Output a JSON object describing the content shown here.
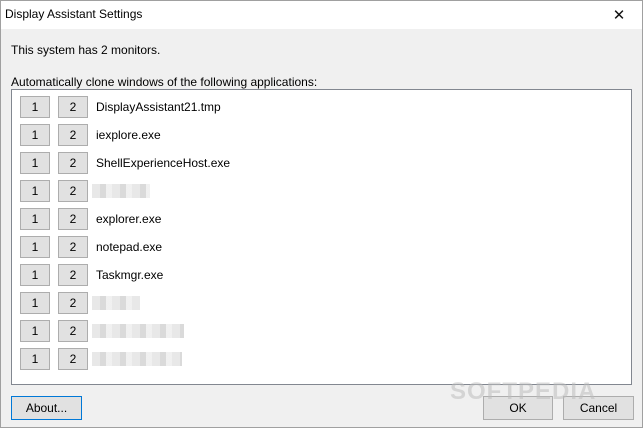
{
  "window": {
    "title": "Display Assistant Settings",
    "close_symbol": "✕"
  },
  "info_text": "This system has 2 monitors.",
  "list_label": "Automatically clone windows of the following applications:",
  "monitor_buttons": [
    "1",
    "2"
  ],
  "apps": [
    {
      "name": "DisplayAssistant21.tmp",
      "blurred": false
    },
    {
      "name": "iexplore.exe",
      "blurred": false
    },
    {
      "name": "ShellExperienceHost.exe",
      "blurred": false
    },
    {
      "name": "",
      "blurred": true
    },
    {
      "name": "explorer.exe",
      "blurred": false
    },
    {
      "name": "notepad.exe",
      "blurred": false
    },
    {
      "name": "Taskmgr.exe",
      "blurred": false
    },
    {
      "name": "",
      "blurred": true
    },
    {
      "name": "",
      "blurred": true
    },
    {
      "name": "",
      "blurred": true
    }
  ],
  "buttons": {
    "about": "About...",
    "ok": "OK",
    "cancel": "Cancel"
  },
  "watermark": "SOFTPEDIA"
}
